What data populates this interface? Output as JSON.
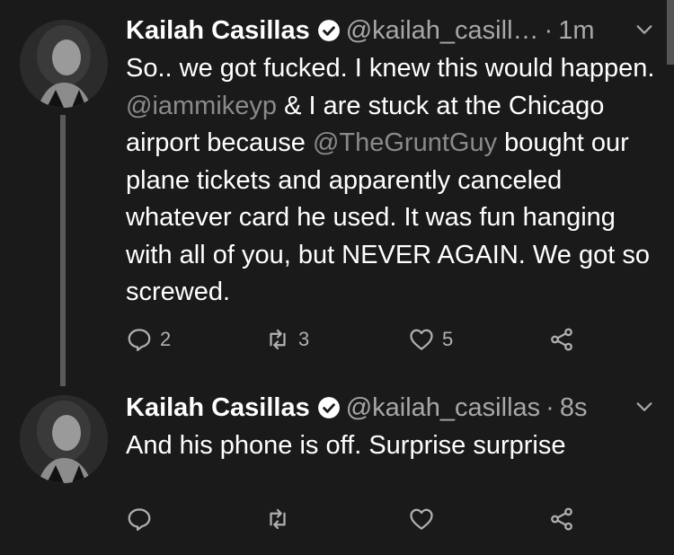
{
  "tweets": [
    {
      "name": "Kailah Casillas",
      "handle": "@kailah_casill…",
      "separator": "·",
      "time": "1m",
      "text_parts": [
        "So.. we got fucked. I knew this would happen. ",
        "@iammikeyp",
        " & I are stuck at the Chicago airport because ",
        "@TheGruntGuy",
        " bought our plane tickets and apparently canceled whatever card he used. It was fun hanging with all of you, but NEVER AGAIN. We got so screwed."
      ],
      "reply_count": "2",
      "retweet_count": "3",
      "like_count": "5"
    },
    {
      "name": "Kailah Casillas",
      "handle": "@kailah_casillas",
      "separator": "·",
      "time": "8s",
      "text": "And his phone is off. Surprise surprise",
      "reply_count": "",
      "retweet_count": "",
      "like_count": ""
    }
  ],
  "icons": {
    "verified": "verified-badge-icon",
    "caret": "chevron-down-icon",
    "reply": "reply-icon",
    "retweet": "retweet-icon",
    "like": "heart-icon",
    "share": "share-icon"
  },
  "colors": {
    "background": "#1a1a1a",
    "text": "#ffffff",
    "secondary": "#a8a8a8",
    "mention": "#8a8a8a"
  }
}
